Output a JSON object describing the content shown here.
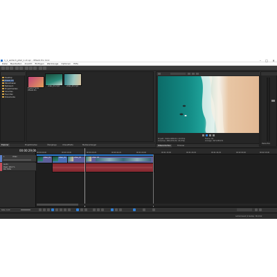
{
  "window": {
    "title": "1_1_einfach_pfad_1.vf.vpr - VEGAS Pro 19.0",
    "min": "–",
    "max": "□",
    "close": "✕"
  },
  "menu": [
    "Datei",
    "Bearbeiten",
    "Ansicht",
    "Einfügen",
    "Werkzeuge",
    "Optionen",
    "Hilfe"
  ],
  "explorer": {
    "tree": [
      "Desktop",
      "Dieser PC",
      "Bibliotheken",
      "Netzwerk",
      "Projektmedien",
      "Vorschau",
      "Favoriten",
      "Dokumente"
    ],
    "thumbs": [
      {
        "label": "Freeze Frame",
        "sub": "VEGAS Pro"
      },
      {
        "label": "video_01.mp4",
        "sub": ""
      },
      {
        "label": "video_02.mp4",
        "sub": ""
      }
    ]
  },
  "lower_tabs": [
    "Explorer",
    "Projektmedien",
    "Übergänge",
    "Videoeffekte",
    "Medienerzeuger"
  ],
  "preview": {
    "info_left": "Projekt: 1920x1080x32; 29,970p",
    "info_left2": "Vorschau: 480x270x32; 29,970p",
    "info_right": "Frame: 42",
    "info_right2": "Anzeige: 497x280x32",
    "tabs": [
      "Videovorschau",
      "Trimmer"
    ]
  },
  "timeline": {
    "timecode": "00:00:29;06",
    "track1_name": "Video",
    "track2_name": "Audio",
    "vol_label": "Pegel: 100,0 %",
    "pan_label": "Pan: Mitte",
    "ruler": [
      "00:00:00;00",
      "00:00:15;00",
      "00:00:29;29",
      "00:00:44;29",
      "00:01:00;00",
      "00:01:15;00",
      "00:01:29;29",
      "00:01:44;29",
      "00:02:00;00",
      "00:02:15;00"
    ],
    "rate": "Rate: 0,00",
    "status_right": "Aufnahmezeit (2 Kanäle): 36:18:42",
    "master": "Master-Bus",
    "clip_labels": [
      "video_01",
      "video_01",
      "video_02",
      "video_02"
    ]
  },
  "colors": {
    "accent": "#2f7fd6",
    "audio_clip": "#8a2a32",
    "video_clip": "#5d5f9a",
    "selection": "#4a6fb5"
  }
}
